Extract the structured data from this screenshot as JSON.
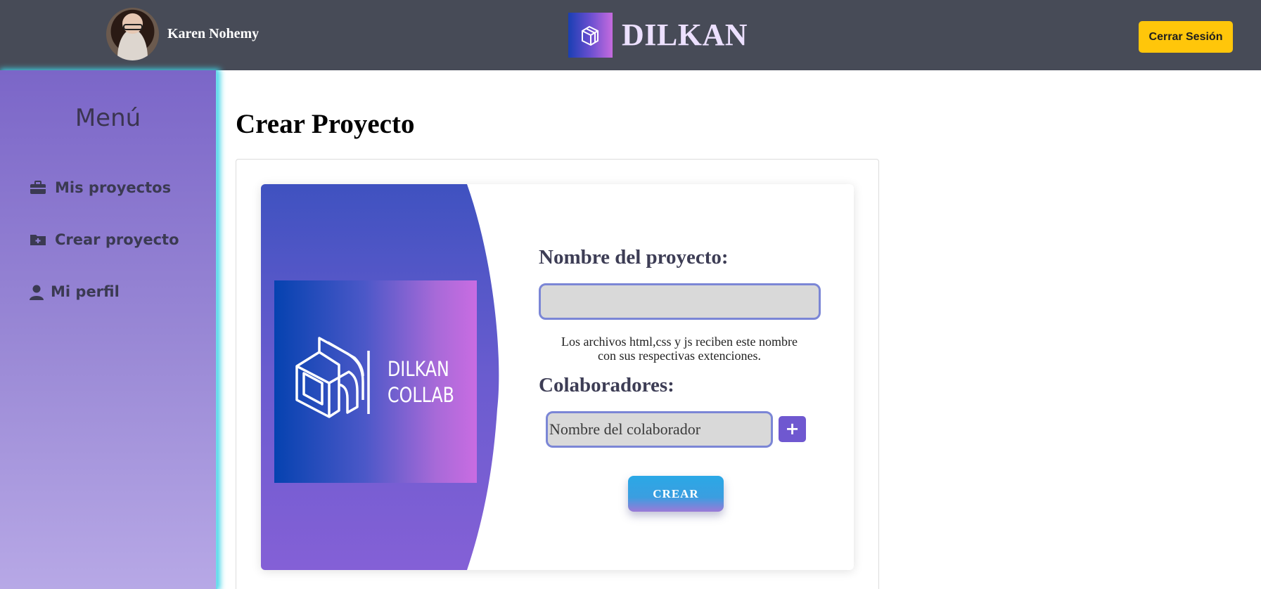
{
  "header": {
    "user_name": "Karen Nohemy",
    "brand": "DILKAN",
    "logout_label": "Cerrar Sesión"
  },
  "sidebar": {
    "title": "Menú",
    "items": [
      {
        "label": "Mis proyectos",
        "icon": "briefcase-icon"
      },
      {
        "label": "Crear proyecto",
        "icon": "folder-plus-icon"
      },
      {
        "label": "Mi perfil",
        "icon": "user-icon"
      }
    ]
  },
  "main": {
    "title": "Crear Proyecto",
    "promo_line1": "DILKAN",
    "promo_line2": "COLLAB",
    "project_name_label": "Nombre del proyecto:",
    "project_name_value": "",
    "hint_line1": "Los archivos html,css y js reciben este nombre",
    "hint_line2": "con sus respectivas extenciones.",
    "collaborators_label": "Colaboradores:",
    "collaborator_placeholder": "Nombre del colaborador",
    "add_label": "+",
    "create_label": "CREAR"
  },
  "colors": {
    "header_bg": "#474b57",
    "logout_bg": "#ffc60a",
    "sidebar_top": "#7b66c8",
    "sidebar_bottom": "#b7a8e6",
    "accent": "#6f58d0"
  }
}
